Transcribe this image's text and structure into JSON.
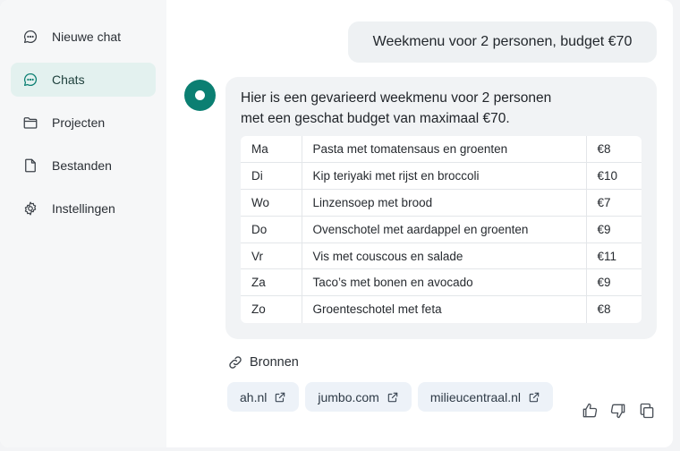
{
  "sidebar": {
    "items": [
      {
        "label": "Nieuwe chat",
        "icon": "chat-bubble-icon",
        "active": false
      },
      {
        "label": "Chats",
        "icon": "chat-bubble-icon",
        "active": true
      },
      {
        "label": "Projecten",
        "icon": "folder-icon",
        "active": false
      },
      {
        "label": "Bestanden",
        "icon": "file-icon",
        "active": false
      },
      {
        "label": "Instellingen",
        "icon": "gear-icon",
        "active": false
      }
    ]
  },
  "conversation": {
    "user_message": "Weekmenu voor 2 personen, budget €70",
    "assistant_intro_line1": "Hier is een gevarieerd weekmenu voor 2 personen",
    "assistant_intro_line2": "met een geschat budget van maximaal €70.",
    "menu": [
      {
        "day": "Ma",
        "meal": "Pasta met tomatensaus en groenten",
        "price": "€8"
      },
      {
        "day": "Di",
        "meal": "Kip teriyaki met rijst en broccoli",
        "price": "€10"
      },
      {
        "day": "Wo",
        "meal": "Linzensoep met brood",
        "price": "€7"
      },
      {
        "day": "Do",
        "meal": "Ovenschotel met aardappel en groenten",
        "price": "€9"
      },
      {
        "day": "Vr",
        "meal": "Vis met couscous en salade",
        "price": "€11"
      },
      {
        "day": "Za",
        "meal": "Taco’s met bonen en avocado",
        "price": "€9"
      },
      {
        "day": "Zo",
        "meal": "Groenteschotel met feta",
        "price": "€8"
      }
    ]
  },
  "sources": {
    "heading": "Bronnen",
    "icon": "link-icon",
    "links": [
      "ah.nl",
      "jumbo.com",
      "milieucentraal.nl"
    ]
  },
  "actions": {
    "icons": [
      "thumbs-up-icon",
      "thumbs-down-icon",
      "copy-icon"
    ]
  },
  "colors": {
    "accent": "#0b7f72",
    "active_nav_bg": "#e3f1ef",
    "chip_bg": "#edf2f8"
  }
}
